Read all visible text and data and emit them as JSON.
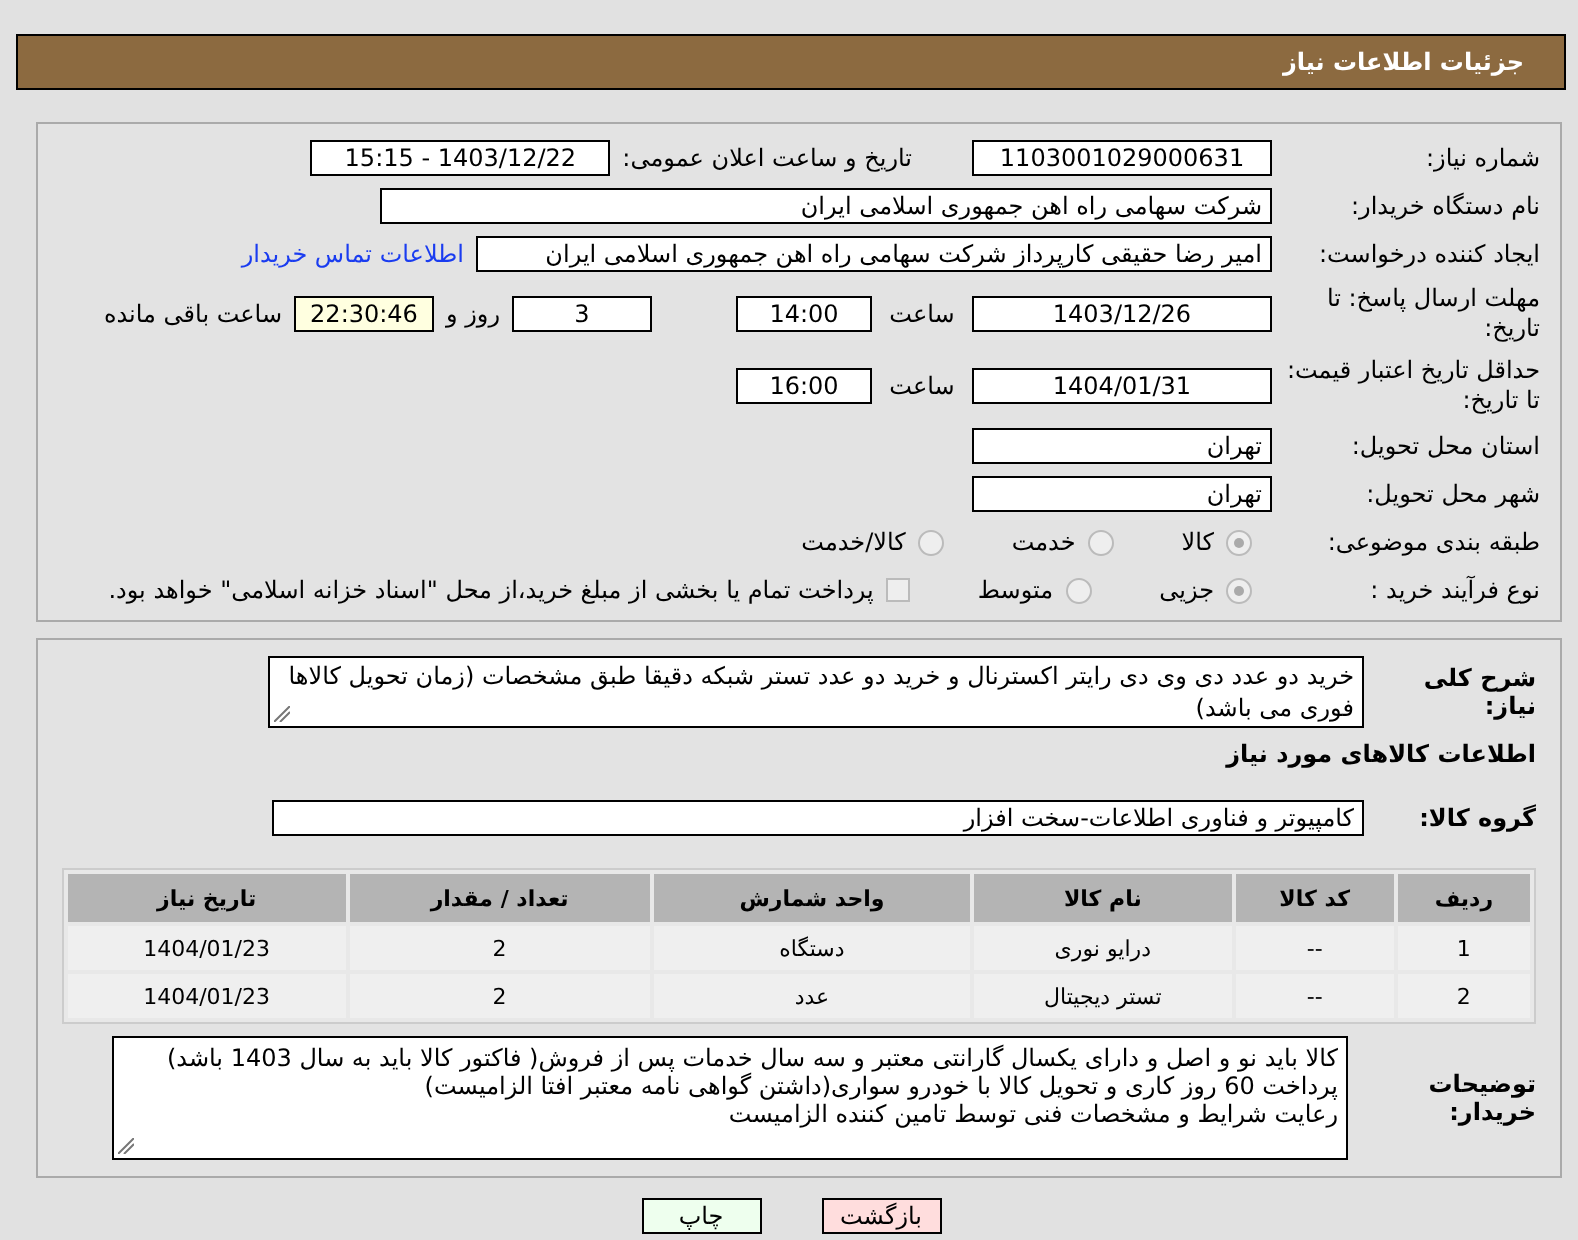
{
  "header": {
    "title": "جزئیات اطلاعات نیاز"
  },
  "need_number": {
    "label": "شماره نیاز:",
    "value": "1103001029000631"
  },
  "announce": {
    "label": "تاریخ و ساعت اعلان عمومی:",
    "value": "1403/12/22 - 15:15"
  },
  "buyer_org": {
    "label": "نام دستگاه خریدار:",
    "value": "شرکت سهامی راه اهن جمهوری اسلامی ایران"
  },
  "requester": {
    "label": "ایجاد کننده درخواست:",
    "value": "امیر رضا  حقیقی کارپرداز شرکت سهامی راه اهن جمهوری اسلامی ایران",
    "link": "اطلاعات تماس خریدار"
  },
  "reply_deadline": {
    "label": "مهلت ارسال پاسخ: تا تاریخ:",
    "date": "1403/12/26",
    "time_label": "ساعت",
    "time": "14:00",
    "days": "3",
    "days_label": "روز و",
    "remaining": "22:30:46",
    "remaining_label": "ساعت باقی مانده"
  },
  "price_validity": {
    "label": "حداقل تاریخ اعتبار قیمت: تا تاریخ:",
    "date": "1404/01/31",
    "time_label": "ساعت",
    "time": "16:00"
  },
  "province": {
    "label": "استان محل تحویل:",
    "value": "تهران"
  },
  "city": {
    "label": "شهر محل تحویل:",
    "value": "تهران"
  },
  "category": {
    "label": "طبقه بندی موضوعی:",
    "options": [
      {
        "label": "کالا",
        "selected": true
      },
      {
        "label": "خدمت",
        "selected": false
      },
      {
        "label": "کالا/خدمت",
        "selected": false
      }
    ]
  },
  "process": {
    "label": "نوع فرآیند خرید :",
    "options": [
      {
        "label": "جزیی",
        "selected": true
      },
      {
        "label": "متوسط",
        "selected": false
      }
    ],
    "payment": {
      "label": "پرداخت تمام یا بخشی از مبلغ خرید،از محل \"اسناد خزانه اسلامی\" خواهد بود.",
      "checked": false
    }
  },
  "summary": {
    "label": "شرح کلی نیاز:",
    "value": "خرید  دو عدد دی وی دی رایتر اکسترنال و خرید دو عدد تستر شبکه دقیقا طبق مشخصات (زمان تحویل کالاها فوری می باشد)"
  },
  "items_heading": "اطلاعات کالاهای مورد نیاز",
  "group": {
    "label": "گروه کالا:",
    "value": "کامپیوتر و فناوری اطلاعات-سخت افزار"
  },
  "table": {
    "columns": [
      "ردیف",
      "کد کالا",
      "نام کالا",
      "واحد شمارش",
      "تعداد / مقدار",
      "تاریخ نیاز"
    ],
    "rows": [
      [
        "1",
        "--",
        "درایو نوری",
        "دستگاه",
        "2",
        "1404/01/23"
      ],
      [
        "2",
        "--",
        "تستر دیجیتال",
        "عدد",
        "2",
        "1404/01/23"
      ]
    ]
  },
  "buyer_notes": {
    "label": "توضیحات خریدار:",
    "lines": [
      "کالا باید نو و اصل و دارای یکسال گارانتی معتبر و سه سال خدمات پس از فروش( فاکتور کالا باید به سال 1403 باشد)",
      "پرداخت 60 روز کاری و تحویل کالا با خودرو سواری(داشتن گواهی نامه معتبر افتا الزامیست)",
      "رعایت شرایط و مشخصات فنی توسط تامین کننده الزامیست"
    ]
  },
  "buttons": [
    {
      "label": "بازگشت",
      "kind": "back"
    },
    {
      "label": "چاپ",
      "kind": "print"
    }
  ]
}
